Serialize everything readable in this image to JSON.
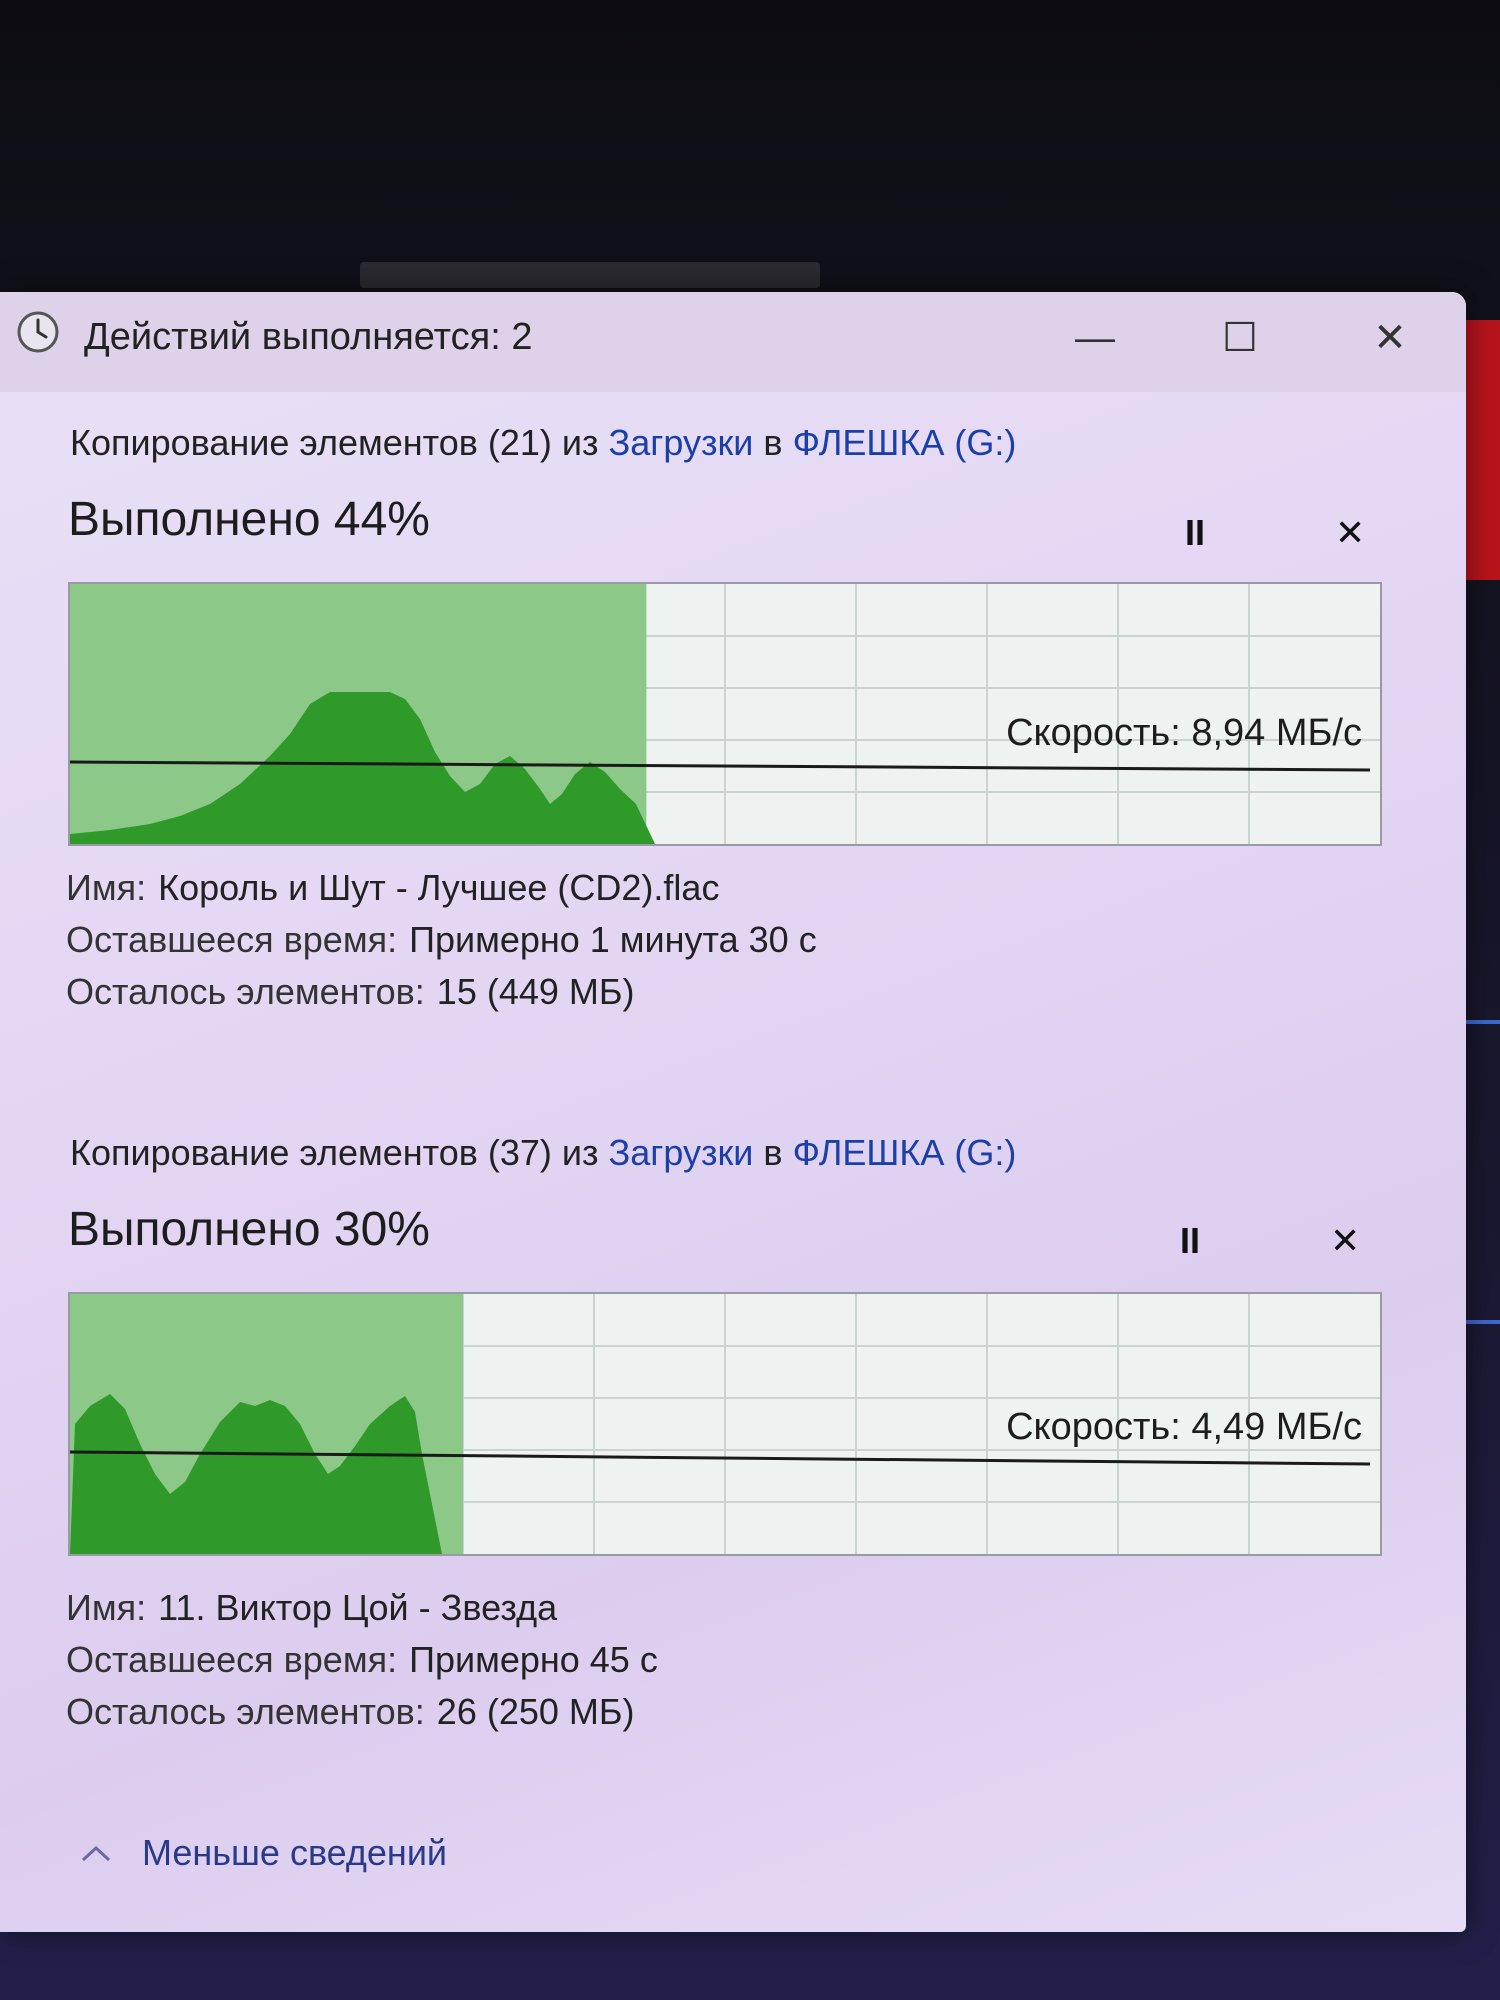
{
  "window": {
    "title": "Действий выполняется: 2",
    "minimize_glyph": "—",
    "maximize_glyph": "☐",
    "close_glyph": "✕"
  },
  "operations": [
    {
      "header_prefix": "Копирование элементов (21) из ",
      "source": "Загрузки",
      "connector": " в ",
      "destination": "ФЛЕШКА (G:)",
      "status": "Выполнено 44%",
      "progress_percent": 44,
      "pause_glyph": "II",
      "cancel_glyph": "✕",
      "speed": "Скорость: 8,94 МБ/с",
      "name_label": "Имя:",
      "name_value": "Король и Шут - Лучшее (CD2).flac",
      "time_label": "Оставшееся время:",
      "time_value": "Примерно 1 минута 30 с",
      "items_label": "Осталось элементов:",
      "items_value": "15 (449 МБ)"
    },
    {
      "header_prefix": "Копирование элементов (37) из ",
      "source": "Загрузки",
      "connector": " в ",
      "destination": "ФЛЕШКА (G:)",
      "status": "Выполнено 30%",
      "progress_percent": 30,
      "pause_glyph": "II",
      "cancel_glyph": "✕",
      "speed": "Скорость: 4,49 МБ/с",
      "name_label": "Имя:",
      "name_value": "11. Виктор Цой - Звезда",
      "time_label": "Оставшееся время:",
      "time_value": "Примерно 45 с",
      "items_label": "Осталось элементов:",
      "items_value": "26 (250 МБ)"
    }
  ],
  "footer": {
    "less_details": "Меньше сведений"
  },
  "colors": {
    "progress_fill": "#8cc888",
    "speed_fill": "#2f9a2a",
    "link": "#1b3fa8"
  }
}
